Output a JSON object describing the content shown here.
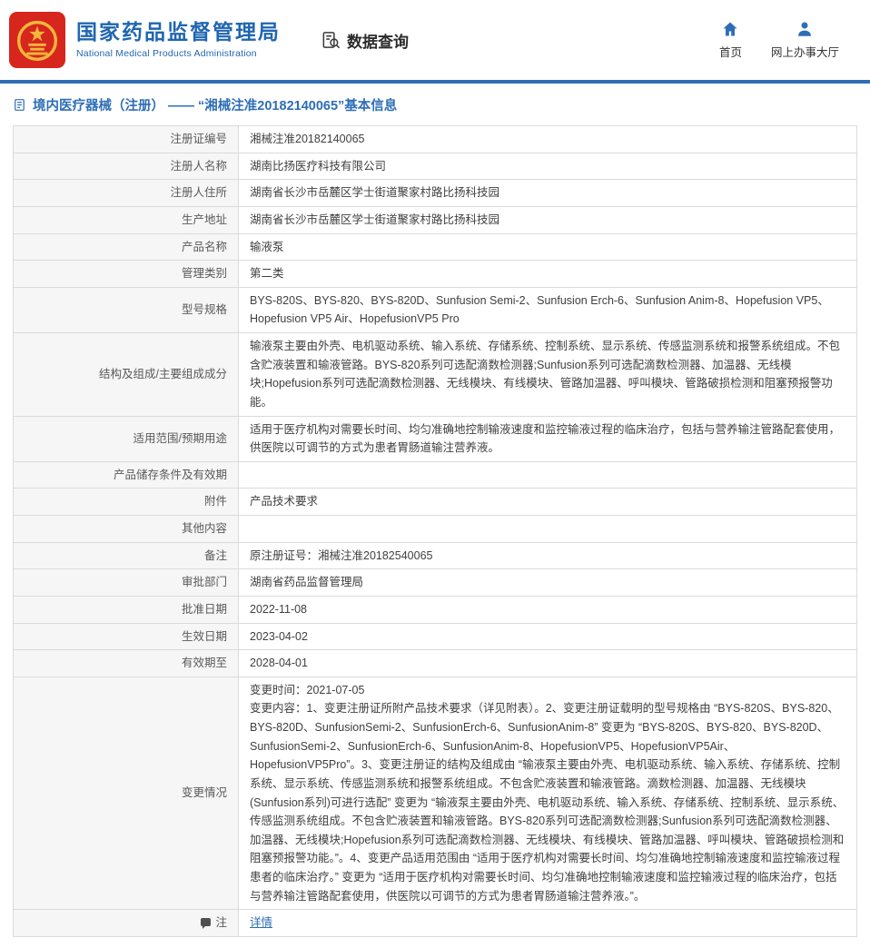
{
  "colors": {
    "accent_blue": "#2e6eb6",
    "logo_red": "#d7261d",
    "logo_gold": "#f2b63c",
    "label_bg": "#f6f6f6",
    "border": "#dbdbdb"
  },
  "header": {
    "site_name": "国家药品监督管理局",
    "site_name_en": "National Medical Products Administration",
    "section_title": "数据查询",
    "nav": [
      {
        "label": "首页"
      },
      {
        "label": "网上办事大厅"
      }
    ]
  },
  "page": {
    "title": "境内医疗器械（注册） —— “湘械注准20182140065”基本信息"
  },
  "table": {
    "rows": [
      {
        "label": "注册证编号",
        "value": "湘械注准20182140065"
      },
      {
        "label": "注册人名称",
        "value": "湖南比扬医疗科技有限公司"
      },
      {
        "label": "注册人住所",
        "value": "湖南省长沙市岳麓区学士街道聚家村路比扬科技园"
      },
      {
        "label": "生产地址",
        "value": "湖南省长沙市岳麓区学士街道聚家村路比扬科技园"
      },
      {
        "label": "产品名称",
        "value": "输液泵"
      },
      {
        "label": "管理类别",
        "value": "第二类"
      },
      {
        "label": "型号规格",
        "value": "BYS-820S、BYS-820、BYS-820D、Sunfusion Semi-2、Sunfusion Erch-6、Sunfusion Anim-8、Hopefusion VP5、Hopefusion VP5 Air、HopefusionVP5 Pro"
      },
      {
        "label": "结构及组成/主要组成成分",
        "value": "输液泵主要由外壳、电机驱动系统、输入系统、存储系统、控制系统、显示系统、传感监测系统和报警系统组成。不包含贮液装置和输液管路。BYS-820系列可选配滴数检测器;Sunfusion系列可选配滴数检测器、加温器、无线模块;Hopefusion系列可选配滴数检测器、无线模块、有线模块、管路加温器、呼叫模块、管路破损检测和阻塞预报警功能。"
      },
      {
        "label": "适用范围/预期用途",
        "value": "适用于医疗机构对需要长时间、均匀准确地控制输液速度和监控输液过程的临床治疗，包括与营养输注管路配套使用，供医院以可调节的方式为患者胃肠道输注营养液。"
      },
      {
        "label": "产品储存条件及有效期",
        "value": ""
      },
      {
        "label": "附件",
        "value": "产品技术要求"
      },
      {
        "label": "其他内容",
        "value": ""
      },
      {
        "label": "备注",
        "value": "原注册证号：湘械注准20182540065"
      },
      {
        "label": "审批部门",
        "value": "湖南省药品监督管理局"
      },
      {
        "label": "批准日期",
        "value": "2022-11-08"
      },
      {
        "label": "生效日期",
        "value": "2023-04-02"
      },
      {
        "label": "有效期至",
        "value": "2028-04-01"
      },
      {
        "label": "变更情况",
        "value": "变更时间：2021-07-05\n变更内容：1、变更注册证所附产品技术要求（详见附表）。2、变更注册证载明的型号规格由 “BYS-820S、BYS-820、BYS-820D、SunfusionSemi-2、SunfusionErch-6、SunfusionAnim-8” 变更为 “BYS-820S、BYS-820、BYS-820D、SunfusionSemi-2、SunfusionErch-6、SunfusionAnim-8、HopefusionVP5、HopefusionVP5Air、HopefusionVP5Pro”。3、变更注册证的结构及组成由 “输液泵主要由外壳、电机驱动系统、输入系统、存储系统、控制系统、显示系统、传感监测系统和报警系统组成。不包含贮液装置和输液管路。滴数检测器、加温器、无线模块(Sunfusion系列)可进行选配” 变更为 “输液泵主要由外壳、电机驱动系统、输入系统、存储系统、控制系统、显示系统、传感监测系统组成。不包含贮液装置和输液管路。BYS-820系列可选配滴数检测器;Sunfusion系列可选配滴数检测器、加温器、无线模块;Hopefusion系列可选配滴数检测器、无线模块、有线模块、管路加温器、呼叫模块、管路破损检测和阻塞预报警功能。”。4、变更产品适用范围由 “适用于医疗机构对需要长时间、均匀准确地控制输液速度和监控输液过程患者的临床治疗。” 变更为 “适用于医疗机构对需要长时间、均匀准确地控制输液速度和监控输液过程的临床治疗，包括与营养输注管路配套使用，供医院以可调节的方式为患者胃肠道输注营养液。”。"
      },
      {
        "label": "注",
        "value": "详情",
        "link": true,
        "icon": "note-icon"
      }
    ]
  }
}
